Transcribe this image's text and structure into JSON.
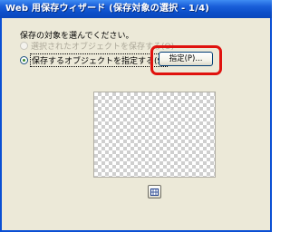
{
  "window": {
    "title": "Web 用保存ウィザード (保存対象の選択 - 1/4)"
  },
  "prompt": "保存の対象を選んでください。",
  "options": [
    {
      "label": "選択されたオブジェクトを保存する(O)",
      "state": "disabled"
    },
    {
      "label": "保存するオブジェクトを指定する(S)",
      "state": "selected"
    }
  ],
  "specify_button": {
    "label": "指定(P)..."
  },
  "preview_button": {
    "icon": "grid-icon"
  },
  "colors": {
    "highlight": "#e0120e",
    "titlebar": "#0b4ec9",
    "face": "#ece9d8"
  }
}
